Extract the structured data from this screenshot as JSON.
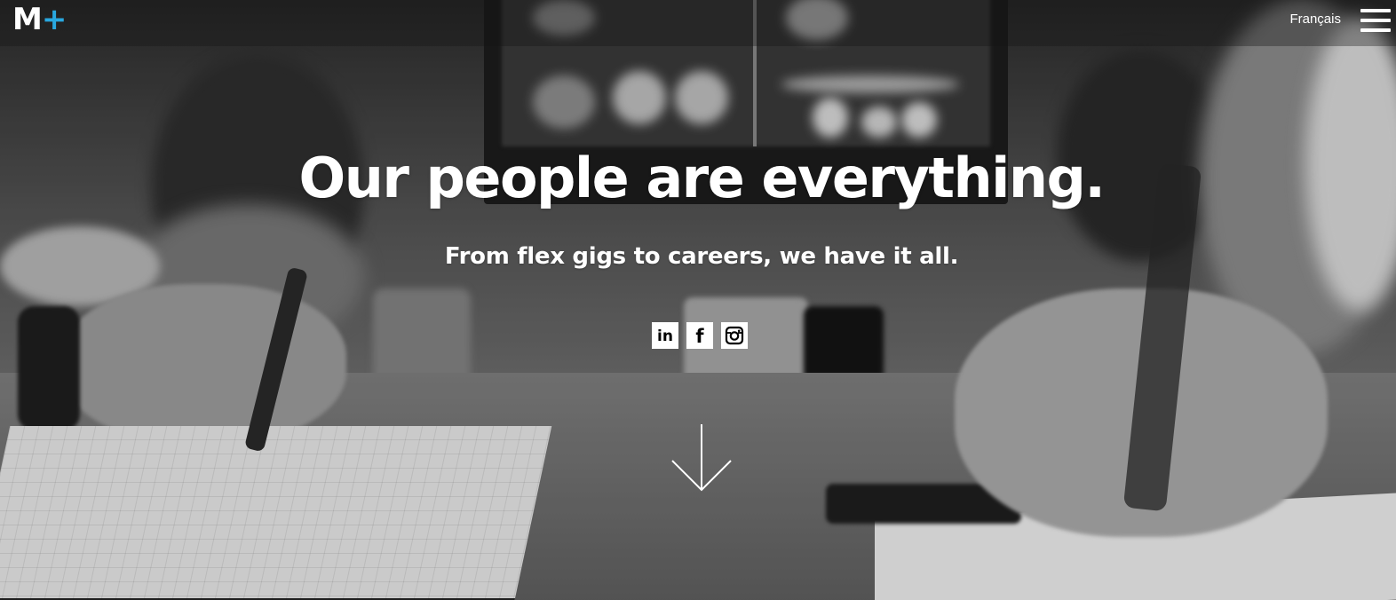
{
  "header": {
    "logo_text": "M",
    "logo_plus": "+",
    "language_link": "Français",
    "menu_icon": "hamburger-menu-icon"
  },
  "hero": {
    "headline": "Our people are everything.",
    "subheadline": "From flex gigs to careers, we have it all.",
    "image": "black-and-white photo of people taking notes at a meeting table",
    "social": [
      {
        "label": "in",
        "icon": "linkedin-icon"
      },
      {
        "label": "f",
        "icon": "facebook-icon"
      },
      {
        "label": "instagram",
        "icon": "instagram-icon"
      }
    ],
    "scroll_icon": "arrow-down-icon"
  },
  "colors": {
    "accent": "#29a8e0",
    "text": "#ffffff",
    "social_tile": "#ffffff",
    "social_glyph": "#000000"
  }
}
